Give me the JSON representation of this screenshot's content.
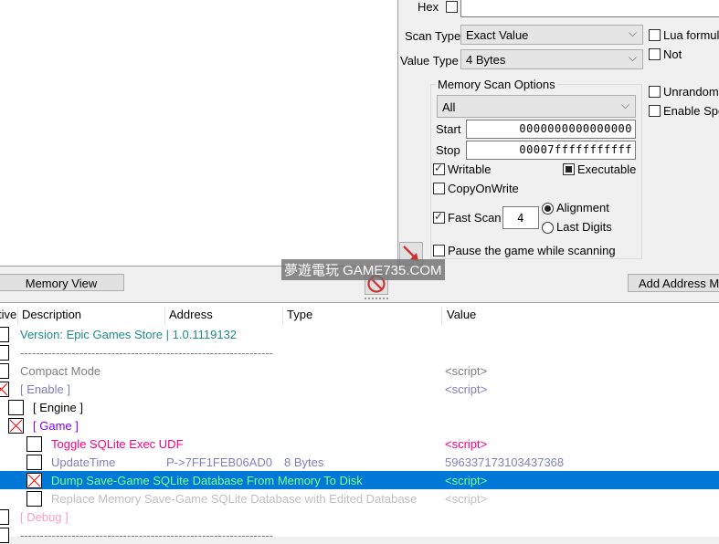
{
  "scan": {
    "hex_label": "Hex",
    "scan_type_label": "Scan Type",
    "scan_type_value": "Exact Value",
    "value_type_label": "Value Type",
    "value_type_value": "4 Bytes",
    "lua_formula_label": "Lua formul",
    "not_label": "Not",
    "unrandomizer_label": "Unrandom",
    "enable_speedhack_label": "Enable Spe"
  },
  "memory_options": {
    "title": "Memory Scan Options",
    "region_value": "All",
    "start_label": "Start",
    "start_value": "0000000000000000",
    "stop_label": "Stop",
    "stop_value": "00007fffffffffff",
    "writable_label": "Writable",
    "executable_label": "Executable",
    "copyonwrite_label": "CopyOnWrite",
    "fastscan_label": "Fast Scan",
    "fastscan_value": "4",
    "alignment_label": "Alignment",
    "lastdigits_label": "Last Digits",
    "pause_label": "Pause the game while scanning"
  },
  "buttons": {
    "memory_view": "Memory View",
    "add_address": "Add Address M"
  },
  "watermark": "夢遊電玩 GAME735.COM",
  "table": {
    "headers": [
      "tive",
      "Description",
      "Address",
      "Type",
      "Value"
    ],
    "rows": [
      {
        "desc": "Version: Epic Games Store | 1.0.1119132",
        "address": "",
        "type": "",
        "value": "",
        "color": "#1e8c8c"
      },
      {
        "desc": "----------------------------------------------------------------",
        "address": "",
        "type": "",
        "value": "",
        "color": "#808080"
      },
      {
        "desc": "Compact Mode",
        "address": "",
        "type": "",
        "value": "<script>",
        "color": "#808080"
      },
      {
        "desc": "[ Enable ]",
        "address": "",
        "type": "",
        "value": "<script>",
        "color": "#8080c0"
      },
      {
        "desc": "[ Engine ]",
        "address": "",
        "type": "",
        "value": "",
        "color": "#000000"
      },
      {
        "desc": "[ Game ]",
        "address": "",
        "type": "",
        "value": "",
        "color": "#8000ff"
      },
      {
        "desc": "Toggle SQLite Exec UDF",
        "address": "",
        "type": "",
        "value": "<script>",
        "color": "#ff0080"
      },
      {
        "desc": "UpdateTime",
        "address": "P->7FF1FEB06AD0",
        "type": "8 Bytes",
        "value": "596337173103437368",
        "color": "#8080c0"
      },
      {
        "desc": "Dump Save-Game SQLite Database From Memory To Disk",
        "address": "",
        "type": "",
        "value": "<script>",
        "color": "#80ff80"
      },
      {
        "desc": "Replace Memory Save-Game SQLite Database with Edited Database",
        "address": "",
        "type": "",
        "value": "<script>",
        "color": "#c0c0c0"
      },
      {
        "desc": "[ Debug ]",
        "address": "",
        "type": "",
        "value": "",
        "color": "#ffa0c0"
      },
      {
        "desc": "----------------------------------------------------------------",
        "address": "",
        "type": "",
        "value": "",
        "color": "#808080"
      }
    ]
  }
}
